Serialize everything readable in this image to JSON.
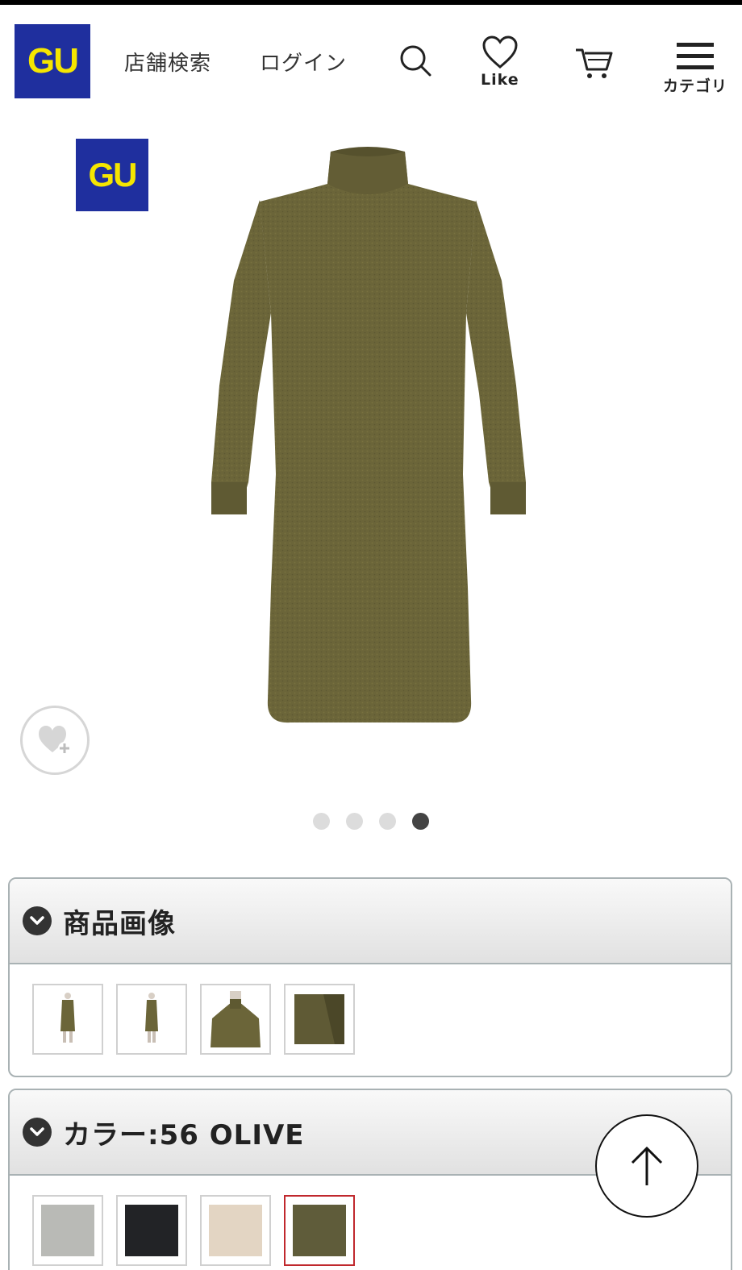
{
  "header": {
    "logo_text": "GU",
    "store_search": "店舗検索",
    "login": "ログイン",
    "like_label": "Like",
    "category_label": "カテゴリ"
  },
  "hero": {
    "logo_text": "GU",
    "image_count": 4,
    "active_slide": 4,
    "product_color": "#6b6539"
  },
  "images_panel": {
    "title": "商品画像",
    "thumbnails": [
      "full-front",
      "full-side",
      "collar-closeup",
      "sleeve-closeup"
    ]
  },
  "color_panel": {
    "title": "カラー:56 OLIVE",
    "swatches": [
      {
        "name": "gray",
        "color": "#b9bab6"
      },
      {
        "name": "black",
        "color": "#222326"
      },
      {
        "name": "beige",
        "color": "#e3d5c3"
      },
      {
        "name": "olive",
        "color": "#5f5c3a",
        "selected": true
      }
    ]
  },
  "colors": {
    "brand_blue": "#1f2f9e",
    "brand_yellow": "#f5e600",
    "selected_border": "#c0282d"
  }
}
